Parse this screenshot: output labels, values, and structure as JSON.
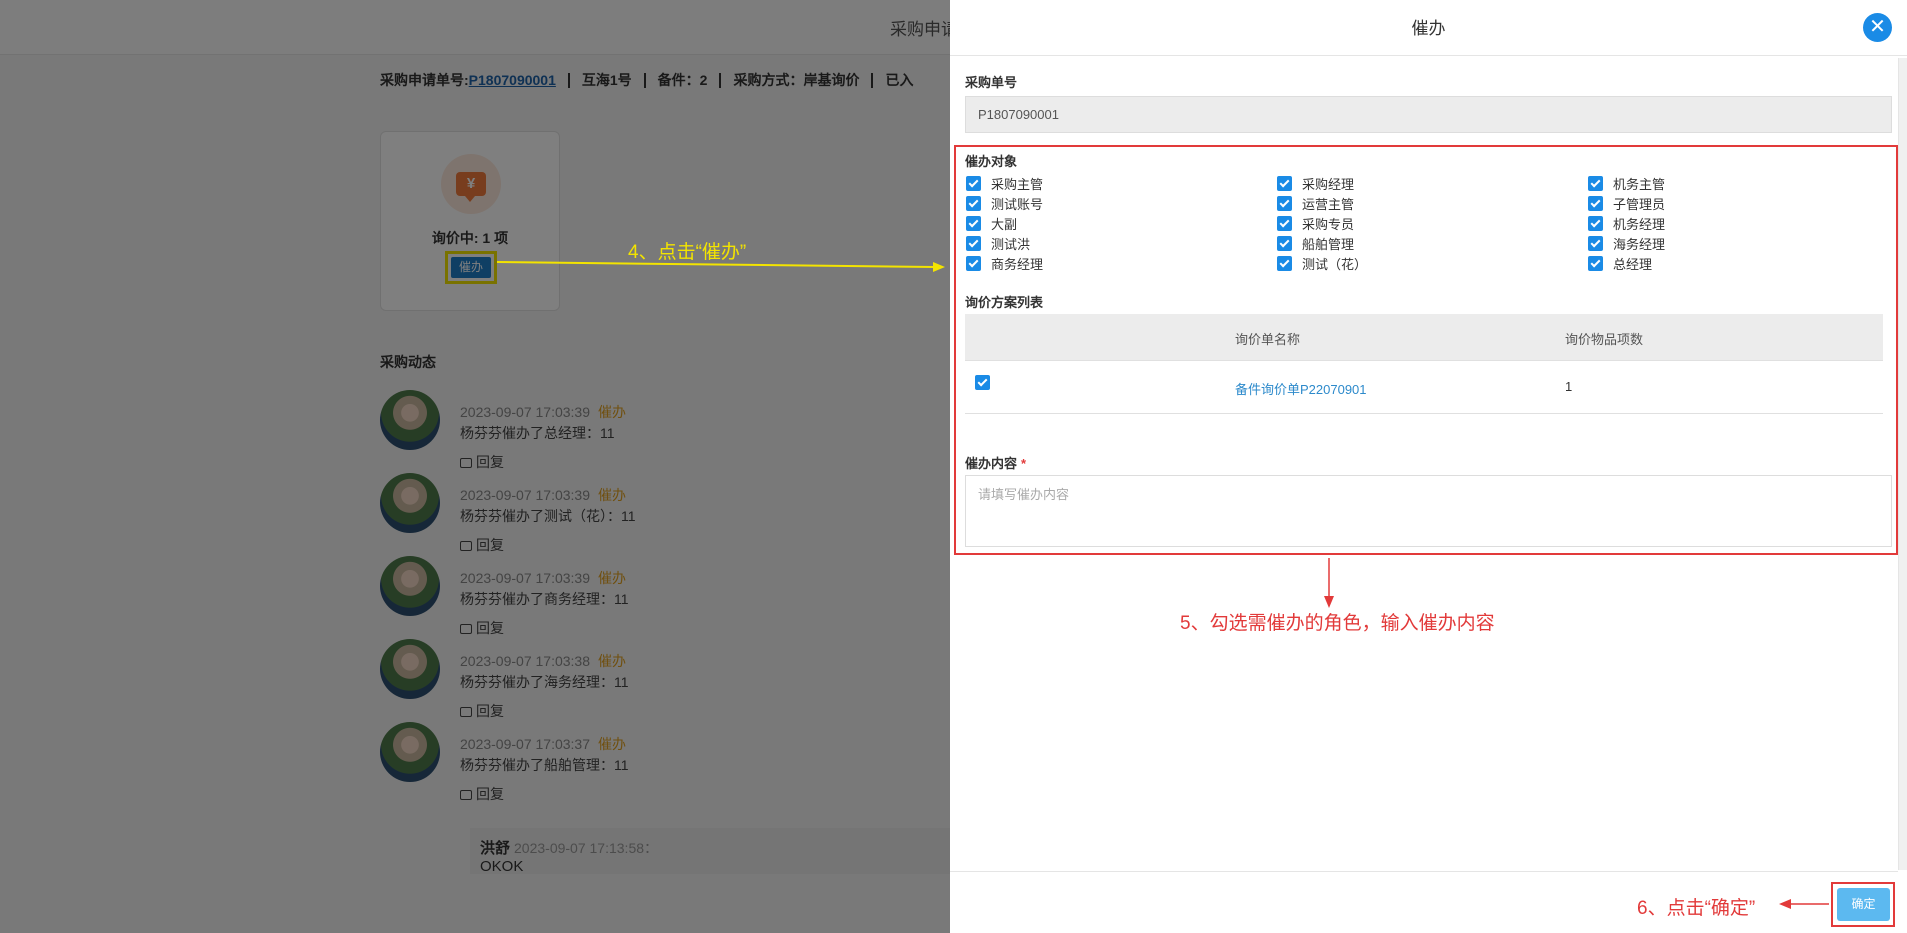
{
  "background": {
    "header_title": "采购申请",
    "info_bar": {
      "order_label": "采购申请单号:",
      "order_no": "P1807090001",
      "vessel": "互海1号",
      "spare": "备件：2",
      "method": "采购方式：岸基询价",
      "status": "已入"
    },
    "card": {
      "icon": "yen-icon",
      "count_text": "询价中: 1 项",
      "urge_button": "催办"
    },
    "section_title": "采购动态",
    "feed": [
      {
        "time": "2023-09-07 17:03:39",
        "tag": "催办",
        "text": "杨芬芬催办了总经理：11",
        "reply": "回复"
      },
      {
        "time": "2023-09-07 17:03:39",
        "tag": "催办",
        "text": "杨芬芬催办了测试（花）：11",
        "reply": "回复"
      },
      {
        "time": "2023-09-07 17:03:39",
        "tag": "催办",
        "text": "杨芬芬催办了商务经理：11",
        "reply": "回复"
      },
      {
        "time": "2023-09-07 17:03:38",
        "tag": "催办",
        "text": "杨芬芬催办了海务经理：11",
        "reply": "回复"
      },
      {
        "time": "2023-09-07 17:03:37",
        "tag": "催办",
        "text": "杨芬芬催办了船舶管理：11",
        "reply": "回复"
      }
    ],
    "comment": {
      "name": "洪舒",
      "time": "2023-09-07 17:13:58：",
      "text": "OKOK"
    }
  },
  "annotations": {
    "step4": "4、点击“催办”",
    "step5": "5、勾选需催办的角色，输入催办内容",
    "step6": "6、点击“确定”",
    "yellow": "#f3e400",
    "red": "#e23a3a"
  },
  "dialog": {
    "title": "催办",
    "close_icon": "close-icon",
    "order_label": "采购单号",
    "order_value": "P1807090001",
    "targets_label": "催办对象",
    "targets": [
      [
        "采购主管",
        "采购经理",
        "机务主管"
      ],
      [
        "测试账号",
        "运营主管",
        "子管理员"
      ],
      [
        "大副",
        "采购专员",
        "机务经理"
      ],
      [
        "测试洪",
        "船舶管理",
        "海务经理"
      ],
      [
        "商务经理",
        "测试（花）",
        "总经理"
      ]
    ],
    "targets_checked": true,
    "plans_label": "询价方案列表",
    "plans_table": {
      "headers": [
        "询价单名称",
        "询价物品项数"
      ],
      "rows": [
        {
          "checked": true,
          "name": "备件询价单P22070901",
          "count": "1"
        }
      ]
    },
    "content_label": "催办内容",
    "content_required": "*",
    "content_placeholder": "请填写催办内容",
    "confirm_button": "确定",
    "accent": "#1a8be6"
  }
}
